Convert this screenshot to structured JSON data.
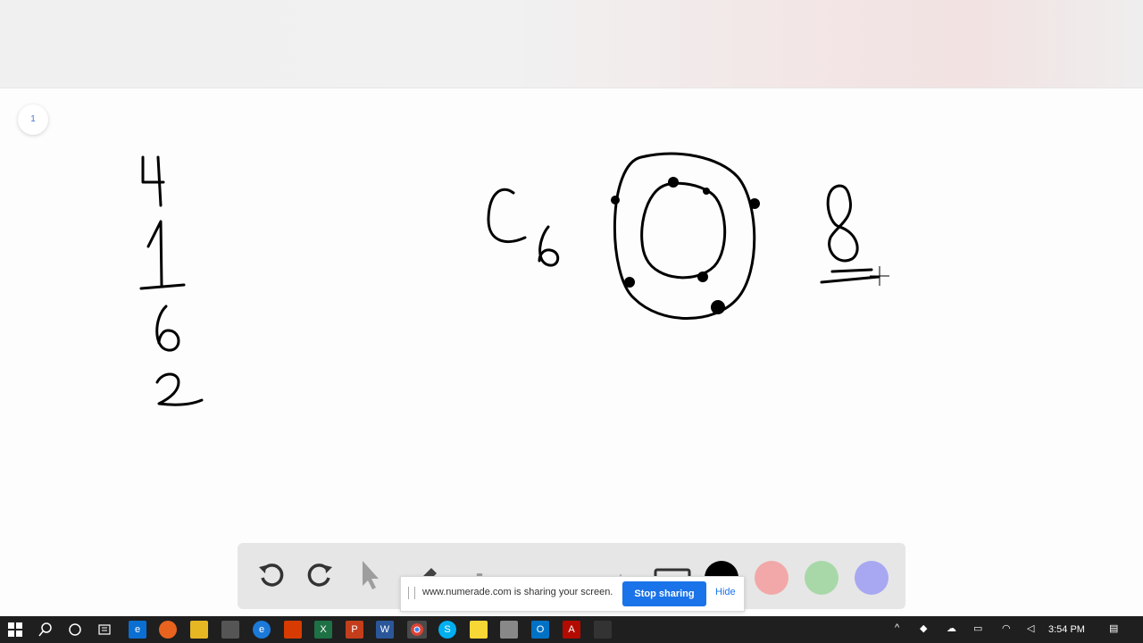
{
  "page": {
    "number": "1"
  },
  "share_notice": {
    "message": "www.numerade.com is sharing your screen.",
    "stop_label": "Stop sharing",
    "hide_label": "Hide"
  },
  "toolbar": {
    "tools": [
      "undo-icon",
      "redo-icon",
      "pointer-icon",
      "pen-icon",
      "highlighter-icon",
      "add-icon",
      "eraser-icon",
      "text-icon",
      "image-icon"
    ],
    "colors": [
      "#000000",
      "#f2a8a8",
      "#a8d8a8",
      "#a8a8f2"
    ]
  },
  "taskbar": {
    "clock": "3:54 PM",
    "apps": [
      "windows-start-icon",
      "search-icon",
      "cortana-icon",
      "task-view-icon",
      "edge-icon",
      "firefox-icon",
      "file-explorer-icon",
      "calculator-icon",
      "edge-beta-icon",
      "office-icon",
      "excel-icon",
      "powerpoint-icon",
      "word-icon",
      "chrome-icon",
      "skype-icon",
      "sticky-notes-icon",
      "snip-icon",
      "outlook-icon",
      "acrobat-icon",
      "media-icon"
    ]
  }
}
